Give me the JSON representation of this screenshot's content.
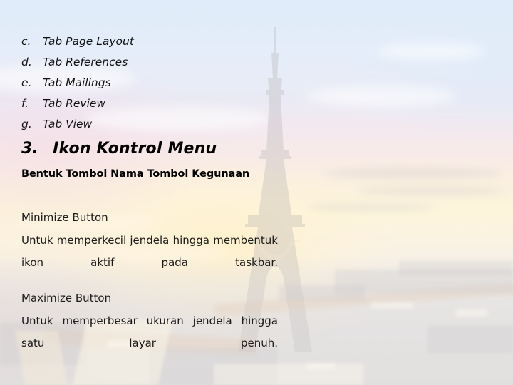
{
  "slide": {
    "background": {
      "scene": "eiffel-tower-sunset-photo",
      "sky_top_color": "#cbdff5",
      "sky_mid_color": "#f3ddd9",
      "sun_glow_color": "#fbeec2",
      "ground_color": "#dcd9d6",
      "tower_color": "#8b8486"
    },
    "text_color": "#111111"
  },
  "sub_list": {
    "items": [
      {
        "marker": "c.",
        "label": "Tab Page Layout"
      },
      {
        "marker": "d.",
        "label": "Tab References"
      },
      {
        "marker": "e.",
        "label": "Tab Mailings"
      },
      {
        "marker": "f.",
        "label": "Tab Review"
      },
      {
        "marker": "g.",
        "label": "Tab View"
      }
    ]
  },
  "section": {
    "number": "3.",
    "title": "Ikon Kontrol Menu",
    "table_headings": "Bentuk Tombol Nama Tombol Kegunaan"
  },
  "paragraphs": [
    {
      "title": "Minimize Button",
      "body": "Untuk memperkecil jendela hingga membentuk ikon aktif pada taskbar."
    },
    {
      "title": "Maximize Button",
      "body": "Untuk memperbesar ukuran jendela hingga satu layar penuh."
    }
  ]
}
